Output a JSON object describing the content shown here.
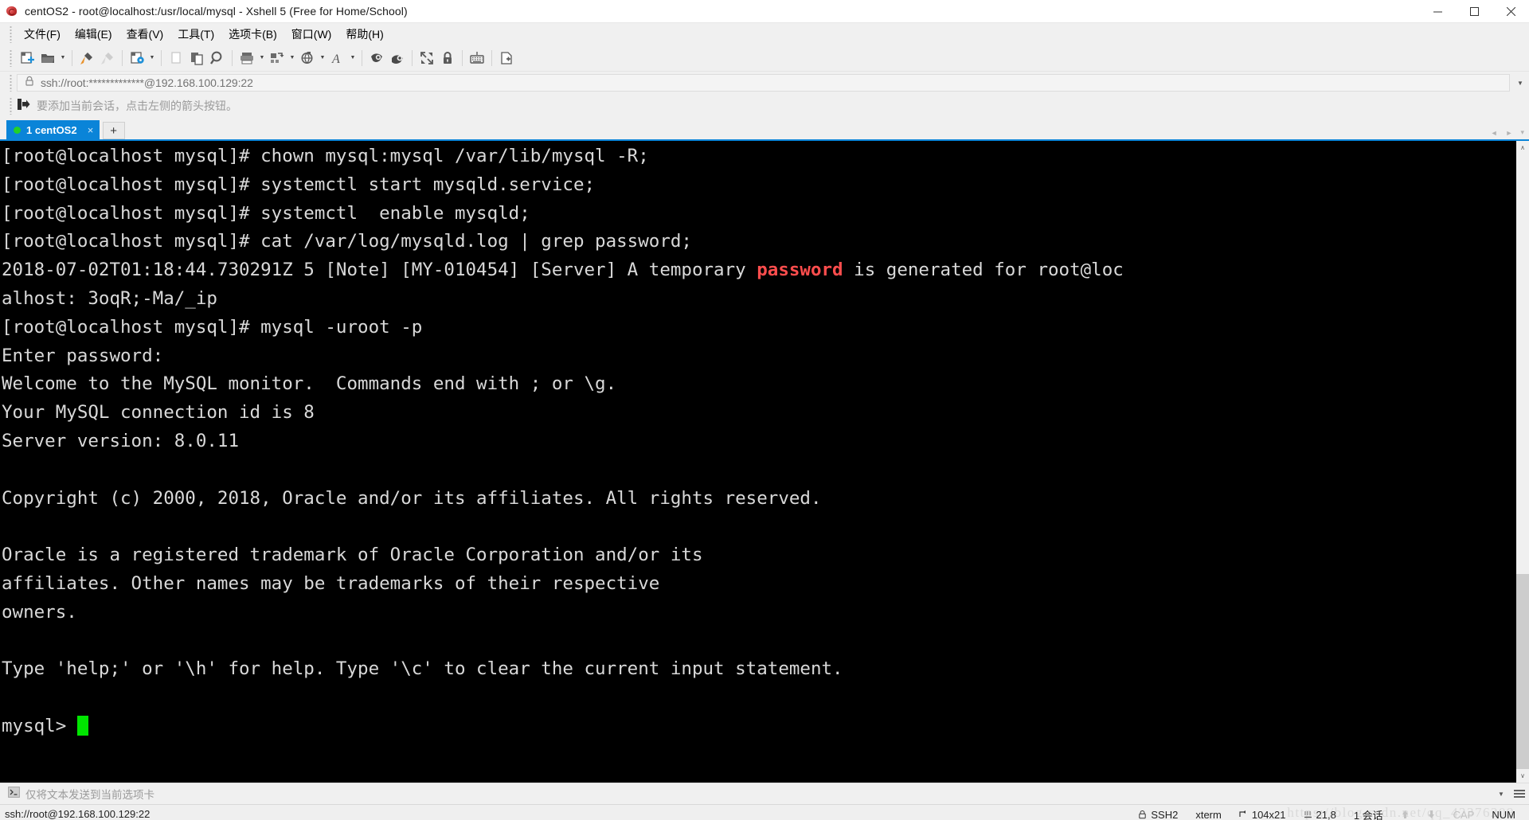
{
  "window": {
    "title": "centOS2 - root@localhost:/usr/local/mysql - Xshell 5 (Free for Home/School)",
    "app_icon": "xshell-shell-icon",
    "minimize_label": "–",
    "maximize_label": "□",
    "close_label": "✕"
  },
  "menubar": {
    "items": [
      {
        "label": "文件(F)",
        "name": "menu-file"
      },
      {
        "label": "编辑(E)",
        "name": "menu-edit"
      },
      {
        "label": "查看(V)",
        "name": "menu-view"
      },
      {
        "label": "工具(T)",
        "name": "menu-tools"
      },
      {
        "label": "选项卡(B)",
        "name": "menu-tabs"
      },
      {
        "label": "窗口(W)",
        "name": "menu-window"
      },
      {
        "label": "帮助(H)",
        "name": "menu-help"
      }
    ]
  },
  "toolbar": {
    "buttons": [
      "new-session-icon",
      "open-folder-icon",
      "folder-dropdown-arrow",
      "sep",
      "connect-icon",
      "disconnect-icon",
      "sep",
      "session-properties-icon",
      "properties-dropdown-arrow",
      "sep",
      "copy-icon",
      "paste-icon",
      "find-icon",
      "sep",
      "print-icon",
      "print-dropdown-arrow",
      "layout-icon",
      "layout-dropdown-arrow",
      "compose-icon",
      "compose-dropdown-arrow",
      "font-icon",
      "font-dropdown-arrow",
      "sep",
      "xftp-icon",
      "xagent-icon",
      "sep",
      "fullscreen-icon",
      "lock-icon",
      "sep",
      "keyboard-icon",
      "sep",
      "new-file-icon"
    ]
  },
  "address_bar": {
    "lock_icon": "lock-icon",
    "value": "ssh://root:*************@192.168.100.129:22",
    "placeholder": "ssh://",
    "dropdown_icon": "chevron-down-icon"
  },
  "hint_bar": {
    "icon": "add-session-arrow-icon",
    "text": "要添加当前会话，点击左侧的箭头按钮。"
  },
  "tabs": {
    "items": [
      {
        "index": "1",
        "label": "1 centOS2",
        "status": "connected",
        "close_label": "×"
      }
    ],
    "new_tab_label": "+",
    "nav_prev": "◄",
    "nav_next": "►",
    "nav_menu": "▾"
  },
  "terminal": {
    "lines": [
      {
        "text": "[root@localhost mysql]# chown mysql:mysql /var/lib/mysql -R;"
      },
      {
        "text": "[root@localhost mysql]# systemctl start mysqld.service;"
      },
      {
        "text": "[root@localhost mysql]# systemctl  enable mysqld;"
      },
      {
        "text": "[root@localhost mysql]# cat /var/log/mysqld.log | grep password;"
      },
      {
        "segments": [
          {
            "t": "2018-07-02T01:18:44.730291Z 5 [Note] [MY-010454] [Server] A temporary "
          },
          {
            "t": "password",
            "hl": true
          },
          {
            "t": " is generated for root@loc"
          }
        ]
      },
      {
        "text": "alhost: 3oqR;-Ma/_ip"
      },
      {
        "text": "[root@localhost mysql]# mysql -uroot -p"
      },
      {
        "text": "Enter password:"
      },
      {
        "text": "Welcome to the MySQL monitor.  Commands end with ; or \\g."
      },
      {
        "text": "Your MySQL connection id is 8"
      },
      {
        "text": "Server version: 8.0.11"
      },
      {
        "text": ""
      },
      {
        "text": "Copyright (c) 2000, 2018, Oracle and/or its affiliates. All rights reserved."
      },
      {
        "text": ""
      },
      {
        "text": "Oracle is a registered trademark of Oracle Corporation and/or its"
      },
      {
        "text": "affiliates. Other names may be trademarks of their respective"
      },
      {
        "text": "owners."
      },
      {
        "text": ""
      },
      {
        "text": "Type 'help;' or '\\h' for help. Type '\\c' to clear the current input statement."
      },
      {
        "text": ""
      },
      {
        "prompt": "mysql> ",
        "cursor": true
      }
    ],
    "colors": {
      "background": "#000000",
      "foreground": "#d9d9d9",
      "highlight": "#ff4d4d",
      "cursor": "#00e500"
    },
    "scrollbar": {
      "up_arrow": "∧",
      "down_arrow": "∨"
    }
  },
  "send_bar": {
    "icon": "terminal-prompt-icon",
    "text": "仅将文本发送到当前选项卡",
    "dropdown_icon": "chevron-down-icon",
    "menu_icon": "hamburger-menu-icon"
  },
  "status_bar": {
    "left": "ssh://root@192.168.100.129:22",
    "cells": [
      {
        "name": "status-protocol",
        "icon": "lock-icon",
        "label": "SSH2"
      },
      {
        "name": "status-terminal-type",
        "icon": "",
        "label": "xterm"
      },
      {
        "name": "status-size",
        "icon": "resize-icon",
        "label": "104x21"
      },
      {
        "name": "status-cursor-pos",
        "icon": "cursor-icon",
        "label": "21,8"
      },
      {
        "name": "status-session-count",
        "icon": "",
        "label": "1 会话"
      },
      {
        "name": "status-transfer-up",
        "icon": "arrow-up-icon",
        "label": ""
      },
      {
        "name": "status-transfer-down",
        "icon": "arrow-down-icon",
        "label": ""
      },
      {
        "name": "status-cap",
        "icon": "",
        "label": "CAP"
      },
      {
        "name": "status-num",
        "icon": "",
        "label": "NUM"
      }
    ],
    "watermark": "https://blog.csdn.net/qq_42376209"
  }
}
